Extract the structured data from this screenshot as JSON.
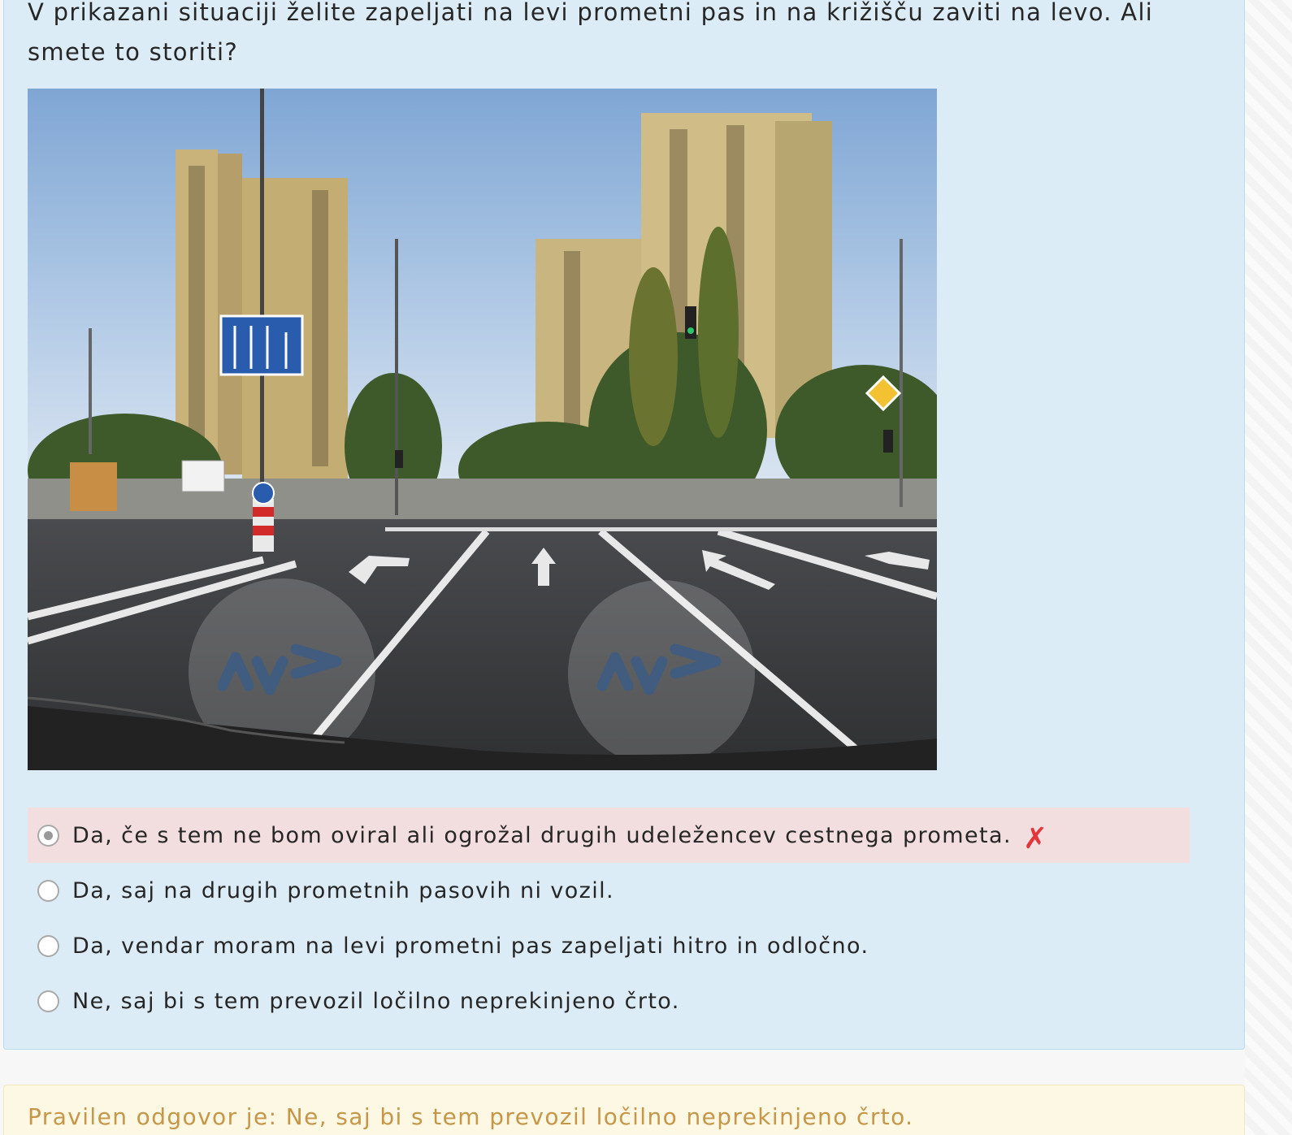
{
  "question": {
    "text": "V prikazani situaciji želite zapeljati na levi prometni pas in na križišču zaviti na levo. Ali smete to storiti?",
    "image_alt": "Pogled iz vozila na križišče s tremi prometnimi pasovi in puščicami",
    "watermark_logo": "AV>"
  },
  "answers": [
    {
      "label": "Da, če s tem ne bom oviral ali ogrožal drugih udeležencev cestnega prometa.",
      "selected": true,
      "status": "wrong"
    },
    {
      "label": "Da, saj na drugih prometnih pasovih ni vozil.",
      "selected": false
    },
    {
      "label": "Da, vendar moram na levi prometni pas zapeljati hitro in odločno.",
      "selected": false
    },
    {
      "label": "Ne, saj bi s tem prevozil ločilno neprekinjeno črto.",
      "selected": false
    }
  ],
  "wrong_mark": "✗",
  "result": {
    "text": "Pravilen odgovor je: Ne, saj bi s tem prevozil ločilno neprekinjeno črto."
  },
  "colors": {
    "card_bg": "#dcecf6",
    "wrong_bg": "#f2dede",
    "wrong_mark": "#e5343a",
    "result_bg": "#fcf8e3",
    "result_text": "#c69649"
  }
}
